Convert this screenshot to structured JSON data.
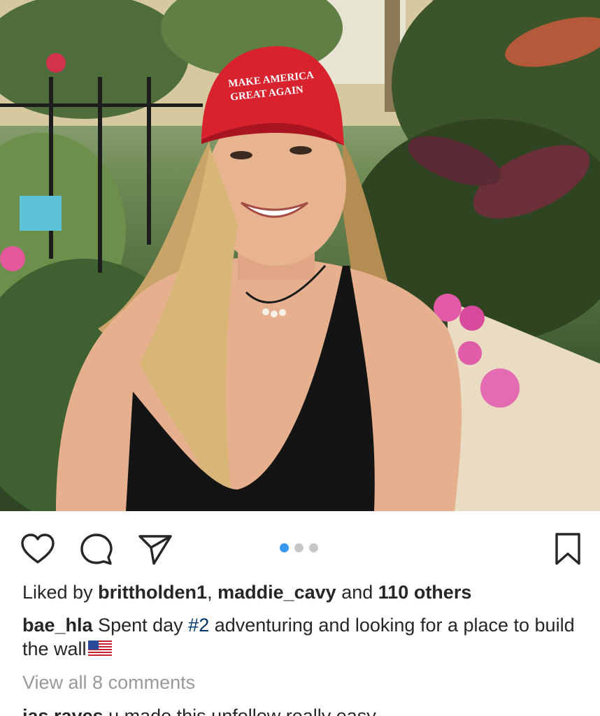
{
  "photo": {
    "hat_text_line1": "MAKE AMERICA",
    "hat_text_line2": "GREAT AGAIN"
  },
  "actions": {
    "like_icon": "heart-outline-icon",
    "comment_icon": "speech-bubble-icon",
    "share_icon": "paper-plane-icon",
    "save_icon": "bookmark-icon",
    "carousel_total": 3,
    "carousel_active": 1,
    "accent_color": "#3897f0"
  },
  "likes": {
    "prefix": "Liked by ",
    "user1": "brittholden1",
    "separator": ", ",
    "user2": "maddie_cavy",
    "middle": " and ",
    "others": "110 others"
  },
  "caption": {
    "username": "bae_hla",
    "text_before": " Spent day ",
    "hashtag": "#2",
    "text_after": " adventuring and looking for a place to build the wall",
    "emoji": "us-flag-emoji"
  },
  "comments": {
    "view_all": "View all 8 comments",
    "first_username": "jas.rayes",
    "first_text": " u made this unfollow really easy"
  }
}
